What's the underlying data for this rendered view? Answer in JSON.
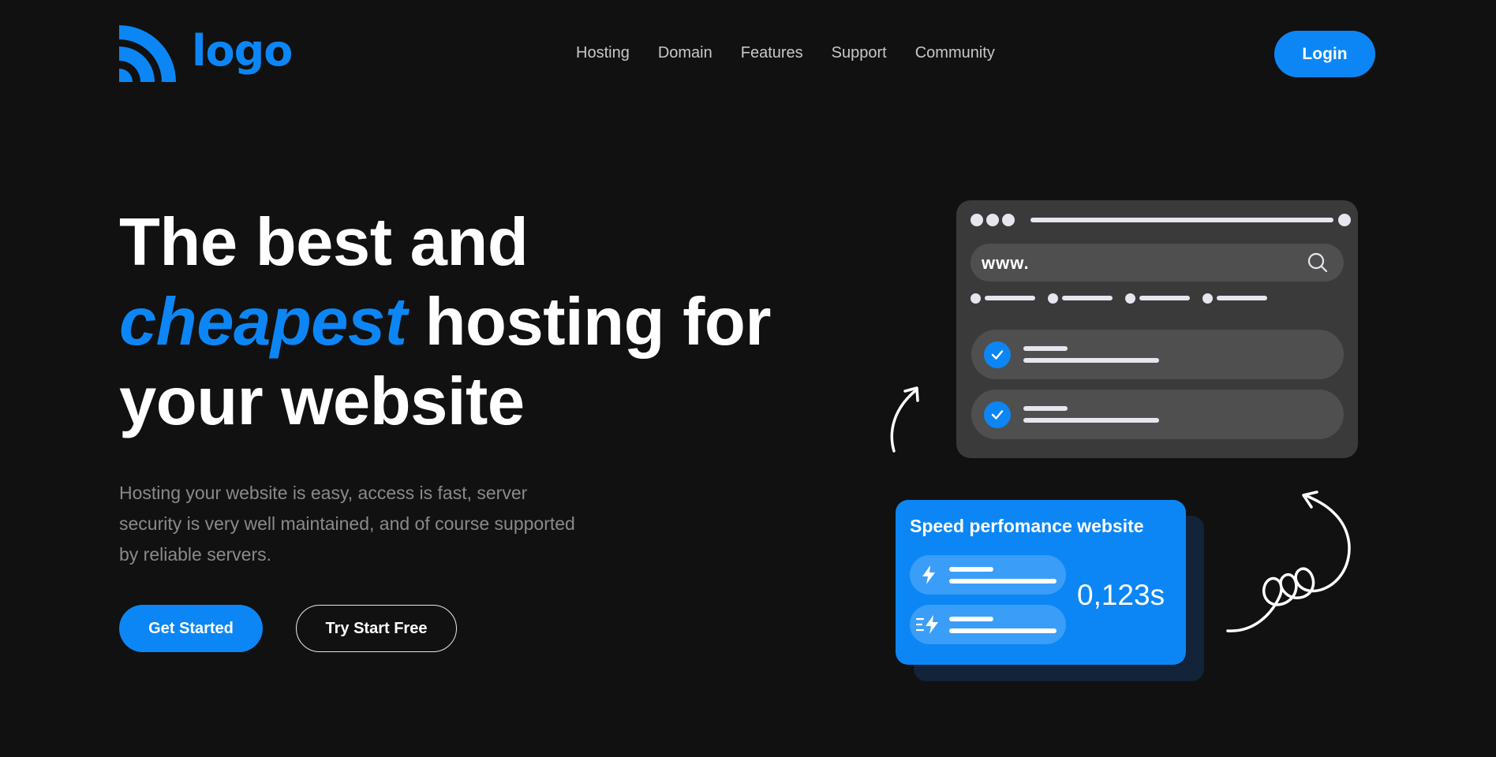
{
  "header": {
    "logo_text": "logo",
    "nav": [
      "Hosting",
      "Domain",
      "Features",
      "Support",
      "Community"
    ],
    "login_label": "Login"
  },
  "hero": {
    "title_line1": "The best and",
    "title_accent": "cheapest",
    "title_line2_rest": " hosting for",
    "title_line3": "your website",
    "description": "Hosting your website is easy, access is fast, server security is very well maintained, and of course supported by reliable servers.",
    "primary_cta": "Get Started",
    "secondary_cta": "Try Start Free"
  },
  "browser_mock": {
    "url_text": "www.",
    "icons": [
      "search-icon",
      "check-icon",
      "check-icon"
    ]
  },
  "speed_card": {
    "title": "Speed perfomance website",
    "value": "0,123s",
    "icons": [
      "lightning-icon",
      "fast-lightning-icon"
    ]
  },
  "colors": {
    "background": "#111111",
    "accent": "#0c86f5",
    "text_muted": "#8a8a8a"
  }
}
